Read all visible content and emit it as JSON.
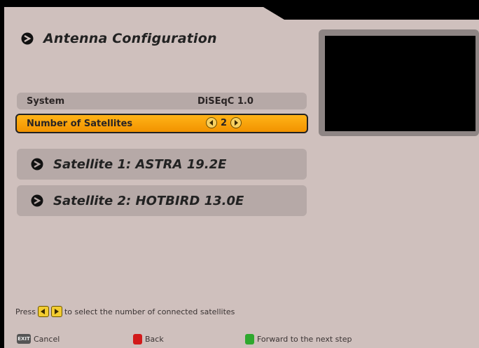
{
  "header": {
    "title": "Antenna Configuration",
    "title_icon": "chevron-right-circle-icon"
  },
  "settings": {
    "system": {
      "label": "System",
      "value": "DiSEqC 1.0"
    },
    "num_satellites": {
      "label": "Number of Satellites",
      "value": "2",
      "selected": true
    }
  },
  "satellites": [
    {
      "label": "Satellite 1: ASTRA 19.2E"
    },
    {
      "label": "Satellite 2: HOTBIRD 13.0E"
    }
  ],
  "hint": {
    "press": "Press",
    "rest": "to select the number of connected satellites"
  },
  "footer": {
    "exit_key": "EXIT",
    "cancel": "Cancel",
    "back": "Back",
    "forward": "Forward to the next step"
  },
  "colors": {
    "panel": "#cfc0bd",
    "row": "#b6a9a7",
    "selected": "#f5a00a",
    "preview_frame": "#8e8584"
  }
}
